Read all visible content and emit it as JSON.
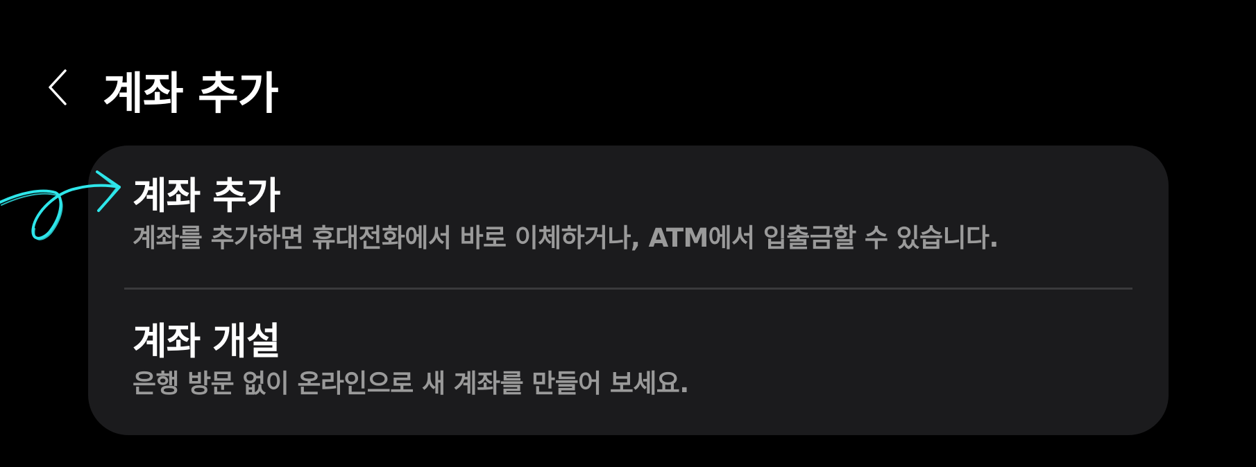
{
  "header": {
    "title": "계좌 추가",
    "back_icon": "chevron-left-icon"
  },
  "menu": {
    "items": [
      {
        "title": "계좌 추가",
        "description": "계좌를 추가하면 휴대전화에서 바로 이체하거나, ATM에서 입출금할 수 있습니다."
      },
      {
        "title": "계좌 개설",
        "description": "은행 방문 없이 온라인으로 새 계좌를 만들어 보세요."
      }
    ]
  },
  "annotation": {
    "icon": "hand-drawn-arrow-icon",
    "color": "#2ee6ea"
  },
  "colors": {
    "background": "#000000",
    "card": "#1b1b1d",
    "title_text": "#ffffff",
    "description_text": "#9a9a9a",
    "divider": "#3a3a3c"
  }
}
